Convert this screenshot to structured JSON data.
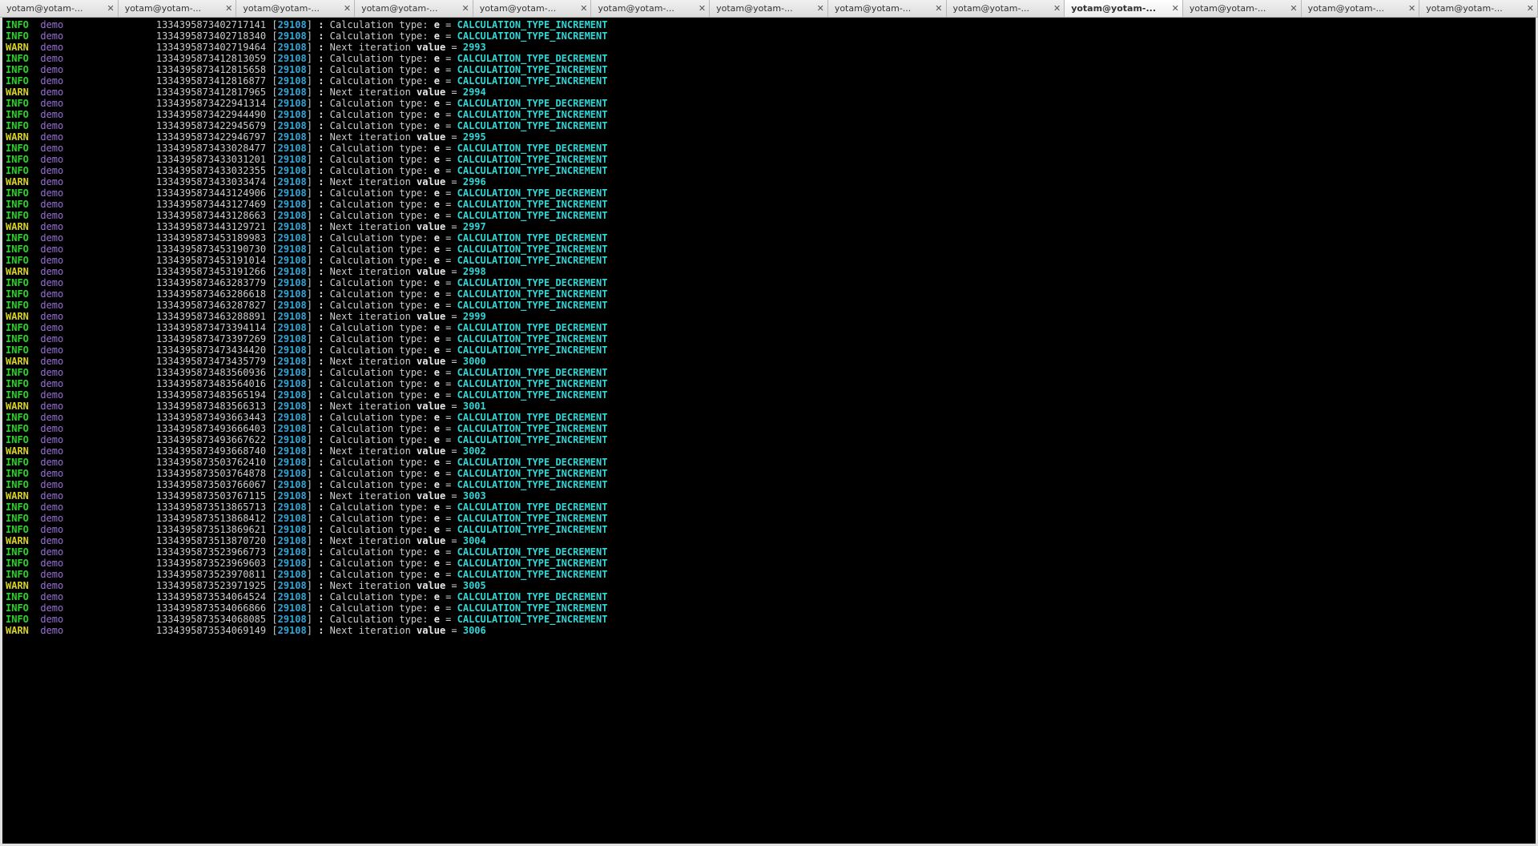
{
  "tabs": {
    "label": "yotam@yotam-...",
    "count": 13,
    "activeIndex": 9
  },
  "pid": "29108",
  "source": "demo",
  "constants": {
    "dec": "CALCULATION_TYPE_DECREMENT",
    "inc": "CALCULATION_TYPE_INCREMENT"
  },
  "text": {
    "calcPrefix": "Calculation type: ",
    "calcVar": "e",
    "eq": " = ",
    "iterPrefix": "Next iteration ",
    "iterVar": "value"
  },
  "lines": [
    {
      "level": "INFO",
      "ts": "1334395873402717141",
      "kind": "calc",
      "val": "inc"
    },
    {
      "level": "INFO",
      "ts": "1334395873402718340",
      "kind": "calc",
      "val": "inc"
    },
    {
      "level": "WARN",
      "ts": "1334395873402719464",
      "kind": "iter",
      "val": "2993"
    },
    {
      "level": "INFO",
      "ts": "1334395873412813059",
      "kind": "calc",
      "val": "dec"
    },
    {
      "level": "INFO",
      "ts": "1334395873412815658",
      "kind": "calc",
      "val": "inc"
    },
    {
      "level": "INFO",
      "ts": "1334395873412816877",
      "kind": "calc",
      "val": "inc"
    },
    {
      "level": "WARN",
      "ts": "1334395873412817965",
      "kind": "iter",
      "val": "2994"
    },
    {
      "level": "INFO",
      "ts": "1334395873422941314",
      "kind": "calc",
      "val": "dec"
    },
    {
      "level": "INFO",
      "ts": "1334395873422944490",
      "kind": "calc",
      "val": "inc"
    },
    {
      "level": "INFO",
      "ts": "1334395873422945679",
      "kind": "calc",
      "val": "inc"
    },
    {
      "level": "WARN",
      "ts": "1334395873422946797",
      "kind": "iter",
      "val": "2995"
    },
    {
      "level": "INFO",
      "ts": "1334395873433028477",
      "kind": "calc",
      "val": "dec"
    },
    {
      "level": "INFO",
      "ts": "1334395873433031201",
      "kind": "calc",
      "val": "inc"
    },
    {
      "level": "INFO",
      "ts": "1334395873433032355",
      "kind": "calc",
      "val": "inc"
    },
    {
      "level": "WARN",
      "ts": "1334395873433033474",
      "kind": "iter",
      "val": "2996"
    },
    {
      "level": "INFO",
      "ts": "1334395873443124906",
      "kind": "calc",
      "val": "dec"
    },
    {
      "level": "INFO",
      "ts": "1334395873443127469",
      "kind": "calc",
      "val": "inc"
    },
    {
      "level": "INFO",
      "ts": "1334395873443128663",
      "kind": "calc",
      "val": "inc"
    },
    {
      "level": "WARN",
      "ts": "1334395873443129721",
      "kind": "iter",
      "val": "2997"
    },
    {
      "level": "INFO",
      "ts": "1334395873453189983",
      "kind": "calc",
      "val": "dec"
    },
    {
      "level": "INFO",
      "ts": "1334395873453190730",
      "kind": "calc",
      "val": "inc"
    },
    {
      "level": "INFO",
      "ts": "1334395873453191014",
      "kind": "calc",
      "val": "inc"
    },
    {
      "level": "WARN",
      "ts": "1334395873453191266",
      "kind": "iter",
      "val": "2998"
    },
    {
      "level": "INFO",
      "ts": "1334395873463283779",
      "kind": "calc",
      "val": "dec"
    },
    {
      "level": "INFO",
      "ts": "1334395873463286618",
      "kind": "calc",
      "val": "inc"
    },
    {
      "level": "INFO",
      "ts": "1334395873463287827",
      "kind": "calc",
      "val": "inc"
    },
    {
      "level": "WARN",
      "ts": "1334395873463288891",
      "kind": "iter",
      "val": "2999"
    },
    {
      "level": "INFO",
      "ts": "1334395873473394114",
      "kind": "calc",
      "val": "dec"
    },
    {
      "level": "INFO",
      "ts": "1334395873473397269",
      "kind": "calc",
      "val": "inc"
    },
    {
      "level": "INFO",
      "ts": "1334395873473434420",
      "kind": "calc",
      "val": "inc"
    },
    {
      "level": "WARN",
      "ts": "1334395873473435779",
      "kind": "iter",
      "val": "3000"
    },
    {
      "level": "INFO",
      "ts": "1334395873483560936",
      "kind": "calc",
      "val": "dec"
    },
    {
      "level": "INFO",
      "ts": "1334395873483564016",
      "kind": "calc",
      "val": "inc"
    },
    {
      "level": "INFO",
      "ts": "1334395873483565194",
      "kind": "calc",
      "val": "inc"
    },
    {
      "level": "WARN",
      "ts": "1334395873483566313",
      "kind": "iter",
      "val": "3001"
    },
    {
      "level": "INFO",
      "ts": "1334395873493663443",
      "kind": "calc",
      "val": "dec"
    },
    {
      "level": "INFO",
      "ts": "1334395873493666403",
      "kind": "calc",
      "val": "inc"
    },
    {
      "level": "INFO",
      "ts": "1334395873493667622",
      "kind": "calc",
      "val": "inc"
    },
    {
      "level": "WARN",
      "ts": "1334395873493668740",
      "kind": "iter",
      "val": "3002"
    },
    {
      "level": "INFO",
      "ts": "1334395873503762410",
      "kind": "calc",
      "val": "dec"
    },
    {
      "level": "INFO",
      "ts": "1334395873503764878",
      "kind": "calc",
      "val": "inc"
    },
    {
      "level": "INFO",
      "ts": "1334395873503766067",
      "kind": "calc",
      "val": "inc"
    },
    {
      "level": "WARN",
      "ts": "1334395873503767115",
      "kind": "iter",
      "val": "3003"
    },
    {
      "level": "INFO",
      "ts": "1334395873513865713",
      "kind": "calc",
      "val": "dec"
    },
    {
      "level": "INFO",
      "ts": "1334395873513868412",
      "kind": "calc",
      "val": "inc"
    },
    {
      "level": "INFO",
      "ts": "1334395873513869621",
      "kind": "calc",
      "val": "inc"
    },
    {
      "level": "WARN",
      "ts": "1334395873513870720",
      "kind": "iter",
      "val": "3004"
    },
    {
      "level": "INFO",
      "ts": "1334395873523966773",
      "kind": "calc",
      "val": "dec"
    },
    {
      "level": "INFO",
      "ts": "1334395873523969603",
      "kind": "calc",
      "val": "inc"
    },
    {
      "level": "INFO",
      "ts": "1334395873523970811",
      "kind": "calc",
      "val": "inc"
    },
    {
      "level": "WARN",
      "ts": "1334395873523971925",
      "kind": "iter",
      "val": "3005"
    },
    {
      "level": "INFO",
      "ts": "1334395873534064524",
      "kind": "calc",
      "val": "dec"
    },
    {
      "level": "INFO",
      "ts": "1334395873534066866",
      "kind": "calc",
      "val": "inc"
    },
    {
      "level": "INFO",
      "ts": "1334395873534068085",
      "kind": "calc",
      "val": "inc"
    },
    {
      "level": "WARN",
      "ts": "1334395873534069149",
      "kind": "iter",
      "val": "3006"
    }
  ]
}
